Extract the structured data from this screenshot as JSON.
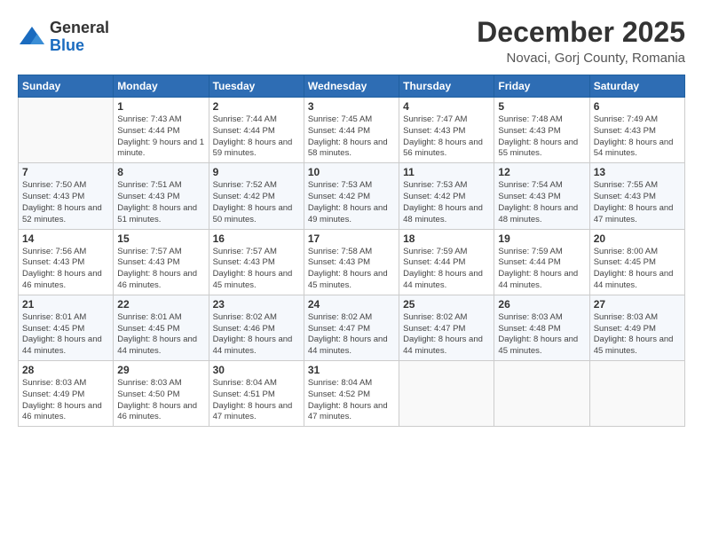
{
  "logo": {
    "general": "General",
    "blue": "Blue"
  },
  "title": "December 2025",
  "location": "Novaci, Gorj County, Romania",
  "weekdays": [
    "Sunday",
    "Monday",
    "Tuesday",
    "Wednesday",
    "Thursday",
    "Friday",
    "Saturday"
  ],
  "weeks": [
    [
      {
        "day": "",
        "sunrise": "",
        "sunset": "",
        "daylight": ""
      },
      {
        "day": "1",
        "sunrise": "Sunrise: 7:43 AM",
        "sunset": "Sunset: 4:44 PM",
        "daylight": "Daylight: 9 hours and 1 minute."
      },
      {
        "day": "2",
        "sunrise": "Sunrise: 7:44 AM",
        "sunset": "Sunset: 4:44 PM",
        "daylight": "Daylight: 8 hours and 59 minutes."
      },
      {
        "day": "3",
        "sunrise": "Sunrise: 7:45 AM",
        "sunset": "Sunset: 4:44 PM",
        "daylight": "Daylight: 8 hours and 58 minutes."
      },
      {
        "day": "4",
        "sunrise": "Sunrise: 7:47 AM",
        "sunset": "Sunset: 4:43 PM",
        "daylight": "Daylight: 8 hours and 56 minutes."
      },
      {
        "day": "5",
        "sunrise": "Sunrise: 7:48 AM",
        "sunset": "Sunset: 4:43 PM",
        "daylight": "Daylight: 8 hours and 55 minutes."
      },
      {
        "day": "6",
        "sunrise": "Sunrise: 7:49 AM",
        "sunset": "Sunset: 4:43 PM",
        "daylight": "Daylight: 8 hours and 54 minutes."
      }
    ],
    [
      {
        "day": "7",
        "sunrise": "Sunrise: 7:50 AM",
        "sunset": "Sunset: 4:43 PM",
        "daylight": "Daylight: 8 hours and 52 minutes."
      },
      {
        "day": "8",
        "sunrise": "Sunrise: 7:51 AM",
        "sunset": "Sunset: 4:43 PM",
        "daylight": "Daylight: 8 hours and 51 minutes."
      },
      {
        "day": "9",
        "sunrise": "Sunrise: 7:52 AM",
        "sunset": "Sunset: 4:42 PM",
        "daylight": "Daylight: 8 hours and 50 minutes."
      },
      {
        "day": "10",
        "sunrise": "Sunrise: 7:53 AM",
        "sunset": "Sunset: 4:42 PM",
        "daylight": "Daylight: 8 hours and 49 minutes."
      },
      {
        "day": "11",
        "sunrise": "Sunrise: 7:53 AM",
        "sunset": "Sunset: 4:42 PM",
        "daylight": "Daylight: 8 hours and 48 minutes."
      },
      {
        "day": "12",
        "sunrise": "Sunrise: 7:54 AM",
        "sunset": "Sunset: 4:43 PM",
        "daylight": "Daylight: 8 hours and 48 minutes."
      },
      {
        "day": "13",
        "sunrise": "Sunrise: 7:55 AM",
        "sunset": "Sunset: 4:43 PM",
        "daylight": "Daylight: 8 hours and 47 minutes."
      }
    ],
    [
      {
        "day": "14",
        "sunrise": "Sunrise: 7:56 AM",
        "sunset": "Sunset: 4:43 PM",
        "daylight": "Daylight: 8 hours and 46 minutes."
      },
      {
        "day": "15",
        "sunrise": "Sunrise: 7:57 AM",
        "sunset": "Sunset: 4:43 PM",
        "daylight": "Daylight: 8 hours and 46 minutes."
      },
      {
        "day": "16",
        "sunrise": "Sunrise: 7:57 AM",
        "sunset": "Sunset: 4:43 PM",
        "daylight": "Daylight: 8 hours and 45 minutes."
      },
      {
        "day": "17",
        "sunrise": "Sunrise: 7:58 AM",
        "sunset": "Sunset: 4:43 PM",
        "daylight": "Daylight: 8 hours and 45 minutes."
      },
      {
        "day": "18",
        "sunrise": "Sunrise: 7:59 AM",
        "sunset": "Sunset: 4:44 PM",
        "daylight": "Daylight: 8 hours and 44 minutes."
      },
      {
        "day": "19",
        "sunrise": "Sunrise: 7:59 AM",
        "sunset": "Sunset: 4:44 PM",
        "daylight": "Daylight: 8 hours and 44 minutes."
      },
      {
        "day": "20",
        "sunrise": "Sunrise: 8:00 AM",
        "sunset": "Sunset: 4:45 PM",
        "daylight": "Daylight: 8 hours and 44 minutes."
      }
    ],
    [
      {
        "day": "21",
        "sunrise": "Sunrise: 8:01 AM",
        "sunset": "Sunset: 4:45 PM",
        "daylight": "Daylight: 8 hours and 44 minutes."
      },
      {
        "day": "22",
        "sunrise": "Sunrise: 8:01 AM",
        "sunset": "Sunset: 4:45 PM",
        "daylight": "Daylight: 8 hours and 44 minutes."
      },
      {
        "day": "23",
        "sunrise": "Sunrise: 8:02 AM",
        "sunset": "Sunset: 4:46 PM",
        "daylight": "Daylight: 8 hours and 44 minutes."
      },
      {
        "day": "24",
        "sunrise": "Sunrise: 8:02 AM",
        "sunset": "Sunset: 4:47 PM",
        "daylight": "Daylight: 8 hours and 44 minutes."
      },
      {
        "day": "25",
        "sunrise": "Sunrise: 8:02 AM",
        "sunset": "Sunset: 4:47 PM",
        "daylight": "Daylight: 8 hours and 44 minutes."
      },
      {
        "day": "26",
        "sunrise": "Sunrise: 8:03 AM",
        "sunset": "Sunset: 4:48 PM",
        "daylight": "Daylight: 8 hours and 45 minutes."
      },
      {
        "day": "27",
        "sunrise": "Sunrise: 8:03 AM",
        "sunset": "Sunset: 4:49 PM",
        "daylight": "Daylight: 8 hours and 45 minutes."
      }
    ],
    [
      {
        "day": "28",
        "sunrise": "Sunrise: 8:03 AM",
        "sunset": "Sunset: 4:49 PM",
        "daylight": "Daylight: 8 hours and 46 minutes."
      },
      {
        "day": "29",
        "sunrise": "Sunrise: 8:03 AM",
        "sunset": "Sunset: 4:50 PM",
        "daylight": "Daylight: 8 hours and 46 minutes."
      },
      {
        "day": "30",
        "sunrise": "Sunrise: 8:04 AM",
        "sunset": "Sunset: 4:51 PM",
        "daylight": "Daylight: 8 hours and 47 minutes."
      },
      {
        "day": "31",
        "sunrise": "Sunrise: 8:04 AM",
        "sunset": "Sunset: 4:52 PM",
        "daylight": "Daylight: 8 hours and 47 minutes."
      },
      {
        "day": "",
        "sunrise": "",
        "sunset": "",
        "daylight": ""
      },
      {
        "day": "",
        "sunrise": "",
        "sunset": "",
        "daylight": ""
      },
      {
        "day": "",
        "sunrise": "",
        "sunset": "",
        "daylight": ""
      }
    ]
  ]
}
